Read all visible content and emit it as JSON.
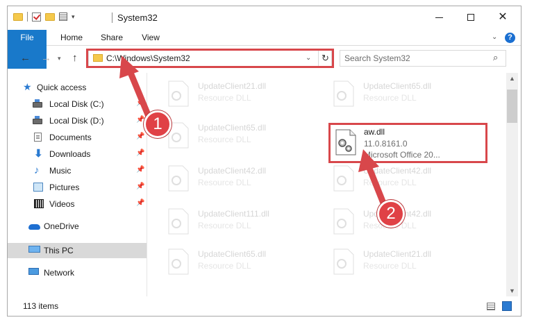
{
  "window": {
    "title": "System32",
    "minimize_label": "",
    "colors": {
      "accent": "#1979ca",
      "highlight": "#d8474b",
      "badge": "#e04146"
    }
  },
  "ribbon": {
    "tabs": [
      {
        "label": "File"
      },
      {
        "label": "Home"
      },
      {
        "label": "Share"
      },
      {
        "label": "View"
      }
    ],
    "help_label": "?"
  },
  "nav": {
    "address_path": "C:\\Windows\\System32",
    "search_placeholder": "Search System32"
  },
  "sidebar": {
    "items": [
      {
        "label": "Quick access",
        "icon": "star-icon"
      },
      {
        "label": "Local Disk (C:)",
        "icon": "drive-icon",
        "pinned": true
      },
      {
        "label": "Local Disk (D:)",
        "icon": "drive-icon",
        "pinned": true
      },
      {
        "label": "Documents",
        "icon": "documents-icon",
        "pinned": true
      },
      {
        "label": "Downloads",
        "icon": "download-icon",
        "pinned": true
      },
      {
        "label": "Music",
        "icon": "music-icon",
        "pinned": true
      },
      {
        "label": "Pictures",
        "icon": "pictures-icon",
        "pinned": true
      },
      {
        "label": "Videos",
        "icon": "videos-icon",
        "pinned": true
      },
      {
        "label": "OneDrive",
        "icon": "cloud-icon"
      },
      {
        "label": "This PC",
        "icon": "computer-icon",
        "selected": true
      },
      {
        "label": "Network",
        "icon": "network-icon"
      }
    ]
  },
  "files": [
    {
      "name": "UpdateClient21.dll",
      "desc": "Resource DLL"
    },
    {
      "name": "UpdateClient65.dll",
      "desc": "Resource DLL"
    },
    {
      "name": "UpdateClient65.dll",
      "desc": "Resource DLL"
    },
    {
      "name": "aw.dll",
      "desc": "11.0.8161.0",
      "desc2": "Microsoft Office 20..."
    },
    {
      "name": "UpdateClient42.dll",
      "desc": "Resource DLL"
    },
    {
      "name": "UpdateClient42.dll",
      "desc": "Resource DLL"
    },
    {
      "name": "UpdateClient111.dll",
      "desc": "Resource DLL"
    },
    {
      "name": "UpdateClient42.dll",
      "desc": "Resource DLL"
    },
    {
      "name": "UpdateClient65.dll",
      "desc": "Resource DLL"
    },
    {
      "name": "UpdateClient21.dll",
      "desc": "Resource DLL"
    }
  ],
  "status": {
    "item_count": "113 items"
  },
  "annotations": {
    "step1": "1",
    "step2": "2"
  }
}
